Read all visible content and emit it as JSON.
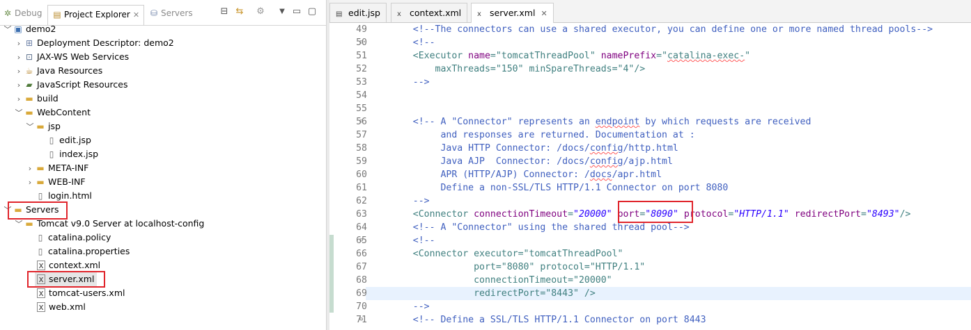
{
  "left_panel": {
    "tabs": [
      {
        "label": "Debug",
        "icon": "debug-icon",
        "active": false
      },
      {
        "label": "Project Explorer",
        "icon": "project-explorer-icon",
        "active": true
      },
      {
        "label": "Servers",
        "icon": "servers-icon",
        "active": false
      }
    ],
    "tree": [
      {
        "label": "demo2",
        "depth": 0,
        "arrow": "down",
        "icon": "project-icon"
      },
      {
        "label": "Deployment Descriptor: demo2",
        "depth": 1,
        "arrow": "right",
        "icon": "deployment-descriptor-icon"
      },
      {
        "label": "JAX-WS Web Services",
        "depth": 1,
        "arrow": "right",
        "icon": "web-services-icon"
      },
      {
        "label": "Java Resources",
        "depth": 1,
        "arrow": "right",
        "icon": "java-resources-icon"
      },
      {
        "label": "JavaScript Resources",
        "depth": 1,
        "arrow": "right",
        "icon": "javascript-resources-icon"
      },
      {
        "label": "build",
        "depth": 1,
        "arrow": "right",
        "icon": "folder-icon"
      },
      {
        "label": "WebContent",
        "depth": 1,
        "arrow": "down",
        "icon": "folder-icon"
      },
      {
        "label": "jsp",
        "depth": 2,
        "arrow": "down",
        "icon": "folder-icon"
      },
      {
        "label": "edit.jsp",
        "depth": 3,
        "arrow": "",
        "icon": "file-icon"
      },
      {
        "label": "index.jsp",
        "depth": 3,
        "arrow": "",
        "icon": "file-icon"
      },
      {
        "label": "META-INF",
        "depth": 2,
        "arrow": "right",
        "icon": "folder-icon"
      },
      {
        "label": "WEB-INF",
        "depth": 2,
        "arrow": "right",
        "icon": "folder-icon"
      },
      {
        "label": "login.html",
        "depth": 2,
        "arrow": "",
        "icon": "file-icon"
      },
      {
        "label": "Servers",
        "depth": 0,
        "arrow": "down",
        "icon": "folder-icon"
      },
      {
        "label": "Tomcat v9.0 Server at localhost-config",
        "depth": 1,
        "arrow": "down",
        "icon": "folder-icon"
      },
      {
        "label": "catalina.policy",
        "depth": 2,
        "arrow": "",
        "icon": "file-icon"
      },
      {
        "label": "catalina.properties",
        "depth": 2,
        "arrow": "",
        "icon": "file-icon"
      },
      {
        "label": "context.xml",
        "depth": 2,
        "arrow": "",
        "icon": "xml-file-icon"
      },
      {
        "label": "server.xml",
        "depth": 2,
        "arrow": "",
        "icon": "xml-file-icon"
      },
      {
        "label": "tomcat-users.xml",
        "depth": 2,
        "arrow": "",
        "icon": "xml-file-icon"
      },
      {
        "label": "web.xml",
        "depth": 2,
        "arrow": "",
        "icon": "xml-file-icon"
      }
    ]
  },
  "editor": {
    "tabs": [
      {
        "label": "edit.jsp",
        "icon": "jsp-file-icon",
        "active": false
      },
      {
        "label": "context.xml",
        "icon": "xml-file-icon",
        "active": false
      },
      {
        "label": "server.xml",
        "icon": "xml-file-icon",
        "active": true
      }
    ],
    "lines": [
      {
        "n": "49",
        "fold": false,
        "parts": [
          [
            "c",
            "    <!--The connectors can use a shared executor, you can define one or more named thread pools-->"
          ]
        ]
      },
      {
        "n": "50",
        "fold": true,
        "parts": [
          [
            "c",
            "    <!--"
          ]
        ]
      },
      {
        "n": "51",
        "fold": false,
        "parts": [
          [
            "t",
            "    <Executor "
          ],
          [
            "a",
            "name"
          ],
          [
            "t",
            "=\"tomcatThreadPool\" "
          ],
          [
            "a",
            "namePrefix"
          ],
          [
            "t",
            "=\""
          ],
          [
            "sq",
            "catalina-exec-"
          ],
          [
            "t",
            "\""
          ]
        ]
      },
      {
        "n": "52",
        "fold": false,
        "parts": [
          [
            "t",
            "        maxThreads=\"150\" minSpareThreads=\"4\"/>"
          ]
        ]
      },
      {
        "n": "53",
        "fold": false,
        "parts": [
          [
            "c",
            "    -->"
          ]
        ]
      },
      {
        "n": "54",
        "fold": false,
        "parts": []
      },
      {
        "n": "55",
        "fold": false,
        "parts": []
      },
      {
        "n": "56",
        "fold": true,
        "parts": [
          [
            "c",
            "    <!-- A \"Connector\" represents an "
          ],
          [
            "sq",
            "endpoint"
          ],
          [
            "c",
            " by which requests are received"
          ]
        ]
      },
      {
        "n": "57",
        "fold": false,
        "parts": [
          [
            "c",
            "         and responses are returned. Documentation at :"
          ]
        ]
      },
      {
        "n": "58",
        "fold": false,
        "parts": [
          [
            "c",
            "         Java HTTP Connector: /docs/"
          ],
          [
            "sq",
            "config"
          ],
          [
            "c",
            "/http.html"
          ]
        ]
      },
      {
        "n": "59",
        "fold": false,
        "parts": [
          [
            "c",
            "         Java AJP  Connector: /docs/"
          ],
          [
            "sq",
            "config"
          ],
          [
            "c",
            "/ajp.html"
          ]
        ]
      },
      {
        "n": "60",
        "fold": false,
        "parts": [
          [
            "c",
            "         APR (HTTP/AJP) Connector: /"
          ],
          [
            "sq",
            "docs"
          ],
          [
            "c",
            "/apr.html"
          ]
        ]
      },
      {
        "n": "61",
        "fold": false,
        "parts": [
          [
            "c",
            "         Define a non-SSL/TLS HTTP/1.1 Connector on port 8080"
          ]
        ]
      },
      {
        "n": "62",
        "fold": false,
        "parts": [
          [
            "c",
            "    -->"
          ]
        ]
      },
      {
        "n": "63",
        "fold": false,
        "parts": [
          [
            "t",
            "    <Connector "
          ],
          [
            "a",
            "connectionTimeout"
          ],
          [
            "t",
            "="
          ],
          [
            "v",
            "\"20000\""
          ],
          [
            "t",
            " "
          ],
          [
            "a",
            "port"
          ],
          [
            "t",
            "="
          ],
          [
            "v",
            "\"8090\""
          ],
          [
            "t",
            " "
          ],
          [
            "a",
            "protocol"
          ],
          [
            "t",
            "="
          ],
          [
            "v",
            "\"HTTP/1.1\""
          ],
          [
            "t",
            " "
          ],
          [
            "a",
            "redirectPort"
          ],
          [
            "t",
            "="
          ],
          [
            "v",
            "\"8493\""
          ],
          [
            "t",
            "/>"
          ]
        ]
      },
      {
        "n": "64",
        "fold": false,
        "parts": [
          [
            "c",
            "    <!-- A \"Connector\" using the shared thread pool-->"
          ]
        ]
      },
      {
        "n": "65",
        "fold": true,
        "parts": [
          [
            "c",
            "    <!--"
          ]
        ]
      },
      {
        "n": "66",
        "fold": false,
        "parts": [
          [
            "t",
            "    <Connector executor=\"tomcatThreadPool\""
          ]
        ]
      },
      {
        "n": "67",
        "fold": false,
        "parts": [
          [
            "t",
            "               port=\"8080\" protocol=\"HTTP/1.1\""
          ]
        ]
      },
      {
        "n": "68",
        "fold": false,
        "parts": [
          [
            "t",
            "               connectionTimeout=\"20000\""
          ]
        ]
      },
      {
        "n": "69",
        "fold": false,
        "parts": [
          [
            "t",
            "               redirectPort=\"8443\" />"
          ]
        ]
      },
      {
        "n": "70",
        "fold": false,
        "parts": [
          [
            "c",
            "    -->"
          ]
        ]
      },
      {
        "n": "71",
        "fold": true,
        "parts": [
          [
            "c",
            "    <!-- Define a SSL/TLS HTTP/1.1 Connector on port 8443"
          ]
        ]
      }
    ],
    "current_line": "69"
  },
  "colors": {
    "highlight_box": "#e0242b",
    "comment": "#3f5fbf",
    "tag": "#3f7f7f",
    "attribute": "#7f007f",
    "value": "#2a00ff",
    "current_line_bg": "#e8f2fe"
  }
}
